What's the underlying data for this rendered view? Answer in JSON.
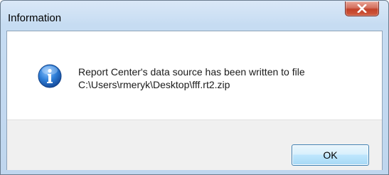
{
  "window": {
    "title": "Information"
  },
  "dialog": {
    "icon": "information-icon",
    "message_line1": "Report Center's data source has been written to file",
    "message_line2": "C:\\Users\\rmeryk\\Desktop\\fff.rt2.zip"
  },
  "buttons": {
    "ok_label": "OK",
    "close_icon": "close-icon"
  },
  "colors": {
    "title_bar": "#c6dcf2",
    "close_button": "#c24129",
    "ok_button": "#bee6fd",
    "footer": "#f0f0f0",
    "info_icon": "#1d62b5"
  }
}
